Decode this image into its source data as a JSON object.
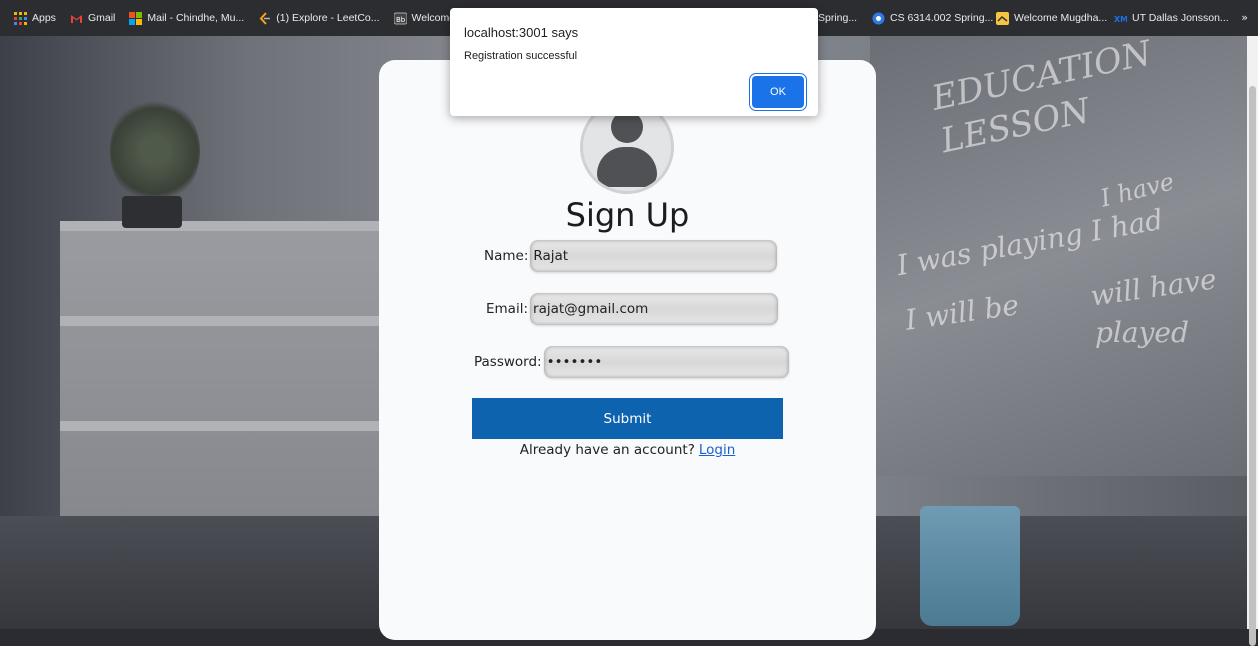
{
  "bookmarks": {
    "items": [
      {
        "label": "Apps",
        "icon": "apps-grid-icon",
        "color": "#f4b400"
      },
      {
        "label": "Gmail",
        "icon": "gmail-icon",
        "color": "#ea4335"
      },
      {
        "label": "Mail - Chindhe, Mu...",
        "icon": "outlook-icon",
        "color": "#f25022"
      },
      {
        "label": "(1) Explore - LeetCo...",
        "icon": "leetcode-icon",
        "color": "#ffa116"
      },
      {
        "label": "Welcome, M",
        "icon": "bb-icon",
        "color": "#555555"
      },
      {
        "label": "Spring...",
        "icon": "",
        "color": ""
      },
      {
        "label": "CS 6314.002 Spring...",
        "icon": "cs-icon",
        "color": "#2c7be5"
      },
      {
        "label": "Welcome Mugdha...",
        "icon": "welcome-icon",
        "color": "#f6c343"
      },
      {
        "label": "UT Dallas Jonsson...",
        "icon": "utd-icon",
        "color": "#1a73e8"
      }
    ],
    "more": "»"
  },
  "form": {
    "title": "Sign Up",
    "name_label": "Name:",
    "name_value": "Rajat",
    "email_label": "Email:",
    "email_value": "rajat@gmail.com",
    "password_label": "Password:",
    "password_value": "•••••••",
    "submit_label": "Submit",
    "login_prompt": "Already have an account?",
    "login_link": "Login"
  },
  "dialog": {
    "title": "localhost:3001 says",
    "message": "Registration successful",
    "ok_label": "OK"
  },
  "background_text": [
    "EDUCATION",
    "LESSON",
    "I have",
    "I was playing I had",
    "I will be",
    "will have",
    "played"
  ],
  "colors": {
    "submit_bg": "#0e63ae",
    "ok_bg": "#1a73e8",
    "link": "#1a5fd6"
  }
}
